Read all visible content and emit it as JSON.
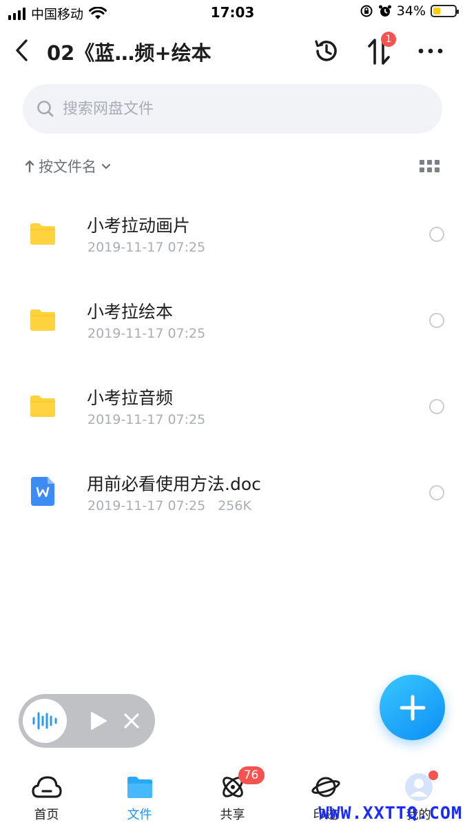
{
  "status_bar": {
    "carrier": "中国移动",
    "time": "17:03",
    "battery_percent": "34%",
    "battery_level": 0.34,
    "icons": [
      "signal-icon",
      "wifi-icon",
      "orientation-lock-icon",
      "alarm-icon",
      "battery-icon"
    ]
  },
  "header": {
    "title": "02《蓝…频+绘本",
    "transfer_badge": "1",
    "icons": [
      "back-icon",
      "history-icon",
      "transfer-icon",
      "more-icon"
    ]
  },
  "search": {
    "placeholder": "搜索网盘文件"
  },
  "sort": {
    "label": "按文件名",
    "icons": [
      "sort-arrow-up-icon",
      "chevron-down-icon",
      "grid-view-icon"
    ]
  },
  "files": [
    {
      "name": "小考拉动画片",
      "date": "2019-11-17 07:25",
      "size": "",
      "type": "folder"
    },
    {
      "name": "小考拉绘本",
      "date": "2019-11-17 07:25",
      "size": "",
      "type": "folder"
    },
    {
      "name": "小考拉音频",
      "date": "2019-11-17 07:25",
      "size": "",
      "type": "folder"
    },
    {
      "name": "用前必看使用方法.doc",
      "date": "2019-11-17 07:25",
      "size": "256K",
      "type": "word"
    }
  ],
  "tabs": [
    {
      "label": "首页",
      "icon": "home-cloud-icon",
      "active": false
    },
    {
      "label": "文件",
      "icon": "folder-icon",
      "active": true
    },
    {
      "label": "共享",
      "icon": "share-orbit-icon",
      "active": false,
      "badge": "76"
    },
    {
      "label": "印迹",
      "icon": "planet-icon",
      "active": false
    },
    {
      "label": "我的",
      "icon": "avatar-icon",
      "active": false
    }
  ],
  "watermark": "WWW.XXTTQ.COM",
  "colors": {
    "accent": "#1e93f5",
    "folder": "#ffd23f",
    "badge": "#f5534f",
    "word": "#3d8bf5"
  }
}
